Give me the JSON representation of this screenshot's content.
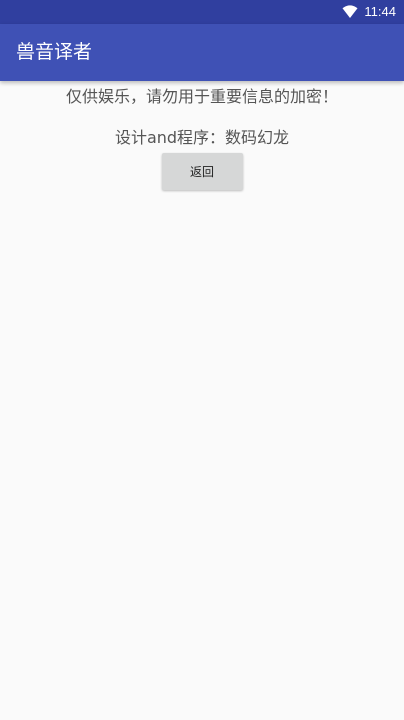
{
  "status_bar": {
    "time": "11:44",
    "icons": [
      "wifi-icon"
    ]
  },
  "app_bar": {
    "title": "兽音译者"
  },
  "main": {
    "notice": "仅供娱乐，请勿用于重要信息的加密！",
    "credits": "设计and程序：数码幻龙",
    "back_button_label": "返回"
  },
  "colors": {
    "status_bar": "#303f9f",
    "app_bar": "#3f51b5",
    "background": "#fafafa",
    "button": "#d6d7d7"
  }
}
